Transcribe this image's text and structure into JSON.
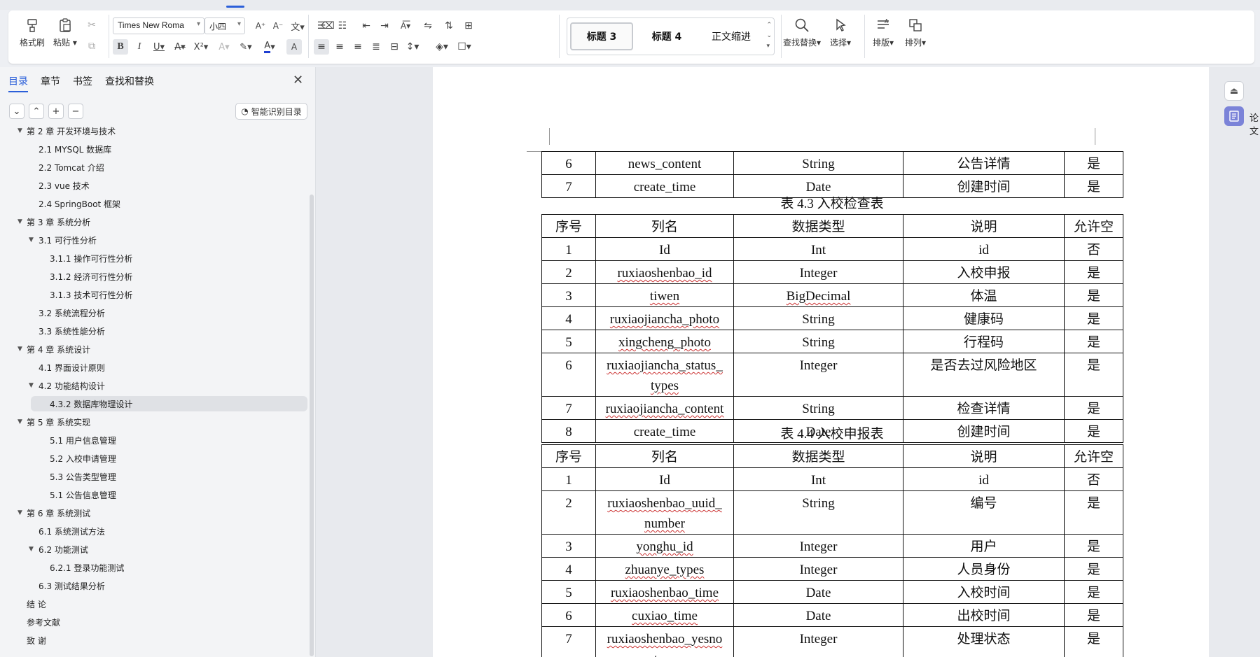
{
  "ribbon": {
    "clipboard": {
      "format_painter": "格式刷",
      "paste": "粘贴"
    },
    "font_name": "Times New Roma",
    "font_size": "小四",
    "styles": [
      "标题 3",
      "标题 4",
      "正文缩进"
    ],
    "find_replace": "查找替换",
    "select": "选择",
    "layout": "排版",
    "arrange": "排列"
  },
  "nav": {
    "tabs": [
      "目录",
      "章节",
      "书签",
      "查找和替换"
    ],
    "active_tab": 0,
    "smart_toc": "智能识别目录",
    "toc": [
      {
        "label": "第 2 章  开发环境与技术",
        "level": 1,
        "expand": true
      },
      {
        "label": "2.1 MYSQL 数据库",
        "level": 2
      },
      {
        "label": "2.2 Tomcat  介绍",
        "level": 2
      },
      {
        "label": "2.3 vue 技术",
        "level": 2
      },
      {
        "label": "2.4 SpringBoot 框架",
        "level": 2
      },
      {
        "label": "第 3 章  系统分析",
        "level": 1,
        "expand": true
      },
      {
        "label": "3.1 可行性分析",
        "level": 2,
        "expand": true
      },
      {
        "label": "3.1.1 操作可行性分析",
        "level": 3
      },
      {
        "label": "3.1.2 经济可行性分析",
        "level": 3
      },
      {
        "label": "3.1.3 技术可行性分析",
        "level": 3
      },
      {
        "label": "3.2 系统流程分析",
        "level": 2
      },
      {
        "label": "3.3 系统性能分析",
        "level": 2
      },
      {
        "label": "第 4 章  系统设计",
        "level": 1,
        "expand": true
      },
      {
        "label": "4.1 界面设计原则",
        "level": 2
      },
      {
        "label": "4.2 功能结构设计",
        "level": 2,
        "expand": true
      },
      {
        "label": "4.3.2  数据库物理设计",
        "level": 3,
        "selected": true
      },
      {
        "label": "第 5 章  系统实现",
        "level": 1,
        "expand": true
      },
      {
        "label": "5.1 用户信息管理",
        "level": 3
      },
      {
        "label": "5.2  入校申请管理",
        "level": 3
      },
      {
        "label": "5.3 公告类型管理",
        "level": 3
      },
      {
        "label": "5.1 公告信息管理",
        "level": 3
      },
      {
        "label": "第 6 章  系统测试",
        "level": 1,
        "expand": true
      },
      {
        "label": "6.1  系统测试方法",
        "level": 2
      },
      {
        "label": "6.2  功能测试",
        "level": 2,
        "expand": true
      },
      {
        "label": "6.2.1  登录功能测试",
        "level": 3
      },
      {
        "label": "6.3  测试结果分析",
        "level": 2
      },
      {
        "label": "结    论",
        "level": 1
      },
      {
        "label": "参考文献",
        "level": 1
      },
      {
        "label": "致    谢",
        "level": 1
      }
    ]
  },
  "document": {
    "table_prev": {
      "rows": [
        [
          "6",
          "news_content",
          "String",
          "公告详情",
          "是"
        ],
        [
          "7",
          "create_time",
          "Date",
          "创建时间",
          "是"
        ]
      ]
    },
    "table_43": {
      "caption": "表 4.3 入校检查表",
      "headers": [
        "序号",
        "列名",
        "数据类型",
        "说明",
        "允许空"
      ],
      "rows": [
        [
          "1",
          "Id",
          "Int",
          "id",
          "否"
        ],
        [
          "2",
          "ruxiaoshenbao_id",
          "Integer",
          "入校申报",
          "是"
        ],
        [
          "3",
          "tiwen",
          "BigDecimal",
          "体温",
          "是"
        ],
        [
          "4",
          "ruxiaojiancha_photo",
          "String",
          "健康码",
          "是"
        ],
        [
          "5",
          "xingcheng_photo",
          "String",
          "行程码",
          "是"
        ],
        [
          "6",
          "ruxiaojiancha_status_\ntypes",
          "Integer",
          "是否去过风险地区",
          "是"
        ],
        [
          "7",
          "ruxiaojiancha_content",
          "String",
          "检查详情",
          "是"
        ],
        [
          "8",
          "create_time",
          "Date",
          "创建时间",
          "是"
        ]
      ]
    },
    "table_44": {
      "caption": "表 4.4 入校申报表",
      "headers": [
        "序号",
        "列名",
        "数据类型",
        "说明",
        "允许空"
      ],
      "rows": [
        [
          "1",
          "Id",
          "Int",
          "id",
          "否"
        ],
        [
          "2",
          "ruxiaoshenbao_uuid_\nnumber",
          "String",
          "编号",
          "是"
        ],
        [
          "3",
          "yonghu_id",
          "Integer",
          "用户",
          "是"
        ],
        [
          "4",
          "zhuanye_types",
          "Integer",
          "人员身份",
          "是"
        ],
        [
          "5",
          "ruxiaoshenbao_time",
          "Date",
          "入校时间",
          "是"
        ],
        [
          "6",
          "cuxiao_time",
          "Date",
          "出校时间",
          "是"
        ],
        [
          "7",
          "ruxiaoshenbao_yesno\n_types",
          "Integer",
          "处理状态",
          "是"
        ]
      ]
    }
  },
  "right_rail": {
    "label": "论文"
  },
  "colors": {
    "accent": "#2b5fd9",
    "rail_active": "#7b83d8"
  }
}
